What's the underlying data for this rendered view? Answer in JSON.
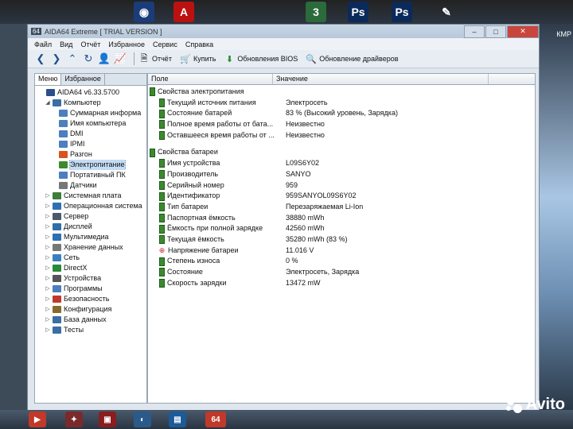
{
  "window": {
    "badge": "64",
    "title": "AIDA64 Extreme  [ TRIAL VERSION ]",
    "controls": [
      "–",
      "□",
      "✕"
    ]
  },
  "desktop": {
    "right_label": "КМР",
    "taskbar_badge": "64",
    "watermark": "Avito"
  },
  "menu": [
    "Файл",
    "Вид",
    "Отчёт",
    "Избранное",
    "Сервис",
    "Справка"
  ],
  "toolbar": {
    "report": "Отчёт",
    "buy": "Купить",
    "bios_updates": "Обновления BIOS",
    "driver_updates": "Обновление драйверов"
  },
  "left_panel": {
    "tabs": [
      "Меню",
      "Избранное"
    ],
    "tree": [
      {
        "label": "AIDA64 v6.33.5700",
        "level": 0,
        "expander": "",
        "icon": "aida-icon"
      },
      {
        "label": "Компьютер",
        "level": 1,
        "expander": "◢",
        "icon": "computer-icon"
      },
      {
        "label": "Суммарная информа",
        "level": 2,
        "expander": "",
        "icon": "summary-icon"
      },
      {
        "label": "Имя компьютера",
        "level": 2,
        "expander": "",
        "icon": "computer-name-icon"
      },
      {
        "label": "DMI",
        "level": 2,
        "expander": "",
        "icon": "dmi-icon"
      },
      {
        "label": "IPMI",
        "level": 2,
        "expander": "",
        "icon": "ipmi-icon"
      },
      {
        "label": "Разгон",
        "level": 2,
        "expander": "",
        "icon": "flame-icon"
      },
      {
        "label": "Электропитание",
        "level": 2,
        "expander": "",
        "icon": "battery-icon",
        "selected": true
      },
      {
        "label": "Портативный ПК",
        "level": 2,
        "expander": "",
        "icon": "laptop-icon"
      },
      {
        "label": "Датчики",
        "level": 2,
        "expander": "",
        "icon": "sensor-icon"
      },
      {
        "label": "Системная плата",
        "level": 1,
        "expander": "▷",
        "icon": "motherboard-icon"
      },
      {
        "label": "Операционная система",
        "level": 1,
        "expander": "▷",
        "icon": "os-icon"
      },
      {
        "label": "Сервер",
        "level": 1,
        "expander": "▷",
        "icon": "server-icon"
      },
      {
        "label": "Дисплей",
        "level": 1,
        "expander": "▷",
        "icon": "display-icon"
      },
      {
        "label": "Мультимедиа",
        "level": 1,
        "expander": "▷",
        "icon": "multimedia-icon"
      },
      {
        "label": "Хранение данных",
        "level": 1,
        "expander": "▷",
        "icon": "storage-icon"
      },
      {
        "label": "Сеть",
        "level": 1,
        "expander": "▷",
        "icon": "network-icon"
      },
      {
        "label": "DirectX",
        "level": 1,
        "expander": "▷",
        "icon": "directx-icon"
      },
      {
        "label": "Устройства",
        "level": 1,
        "expander": "▷",
        "icon": "devices-icon"
      },
      {
        "label": "Программы",
        "level": 1,
        "expander": "▷",
        "icon": "programs-icon"
      },
      {
        "label": "Безопасность",
        "level": 1,
        "expander": "▷",
        "icon": "security-icon"
      },
      {
        "label": "Конфигурация",
        "level": 1,
        "expander": "▷",
        "icon": "config-icon"
      },
      {
        "label": "База данных",
        "level": 1,
        "expander": "▷",
        "icon": "database-icon"
      },
      {
        "label": "Тесты",
        "level": 1,
        "expander": "▷",
        "icon": "tests-icon"
      }
    ]
  },
  "grid": {
    "columns": [
      "Поле",
      "Значение"
    ],
    "groups": [
      {
        "title": "Свойства электропитания",
        "rows": [
          {
            "field": "Текущий источник питания",
            "value": "Электросеть"
          },
          {
            "field": "Состояние батарей",
            "value": "83 % (Высокий уровень, Зарядка)"
          },
          {
            "field": "Полное время работы от бата...",
            "value": "Неизвестно"
          },
          {
            "field": "Оставшееся время работы от ...",
            "value": "Неизвестно"
          }
        ]
      },
      {
        "title": "Свойства батареи",
        "rows": [
          {
            "field": "Имя устройства",
            "value": "L09S6Y02"
          },
          {
            "field": "Производитель",
            "value": "SANYO"
          },
          {
            "field": "Серийный номер",
            "value": "959"
          },
          {
            "field": "Идентификатор",
            "value": "959SANYOL09S6Y02"
          },
          {
            "field": "Тип батареи",
            "value": "Перезаряжаемая Li-Ion"
          },
          {
            "field": "Паспортная ёмкость",
            "value": "38880 mWh"
          },
          {
            "field": "Ёмкость при полной зарядке",
            "value": "42560 mWh"
          },
          {
            "field": "Текущая ёмкость",
            "value": "35280 mWh  (83 %)"
          },
          {
            "field": "Напряжение батареи",
            "value": "11.016 V",
            "icon": "voltage"
          },
          {
            "field": "Степень износа",
            "value": "0 %"
          },
          {
            "field": "Состояние",
            "value": "Электросеть, Зарядка"
          },
          {
            "field": "Скорость зарядки",
            "value": "13472 mW"
          }
        ]
      }
    ]
  }
}
